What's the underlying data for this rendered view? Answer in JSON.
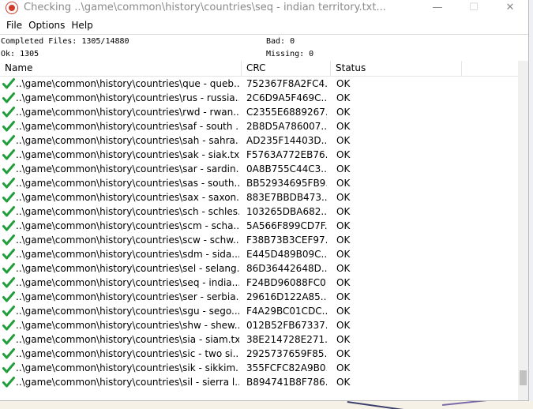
{
  "window": {
    "title": "Checking ..\\game\\common\\history\\countries\\seq - indian territory.txt...",
    "minimize_glyph": "—",
    "maximize_glyph": "☐",
    "close_glyph": "✕"
  },
  "menu": [
    "File",
    "Options",
    "Help"
  ],
  "stats": {
    "completed": "Completed Files: 1305/14880",
    "bad": "Bad: 0",
    "ok": "Ok: 1305",
    "missing": "Missing: 0"
  },
  "columns": {
    "name": "Name",
    "crc": "CRC",
    "status": "Status"
  },
  "rows": [
    {
      "name": "..\\game\\common\\history\\countries\\que - queb...",
      "crc": "752367F8A2FC4...",
      "status": "OK"
    },
    {
      "name": "..\\game\\common\\history\\countries\\rus - russia...",
      "crc": "2C6D9A5F469C...",
      "status": "OK"
    },
    {
      "name": "..\\game\\common\\history\\countries\\rwd - rwan...",
      "crc": "C2355E6889267...",
      "status": "OK"
    },
    {
      "name": "..\\game\\common\\history\\countries\\saf - south ...",
      "crc": "2B8D5A786007...",
      "status": "OK"
    },
    {
      "name": "..\\game\\common\\history\\countries\\sah - sahra...",
      "crc": "AD235F14403D...",
      "status": "OK"
    },
    {
      "name": "..\\game\\common\\history\\countries\\sak - siak.txt",
      "crc": "F5763A772EB76...",
      "status": "OK"
    },
    {
      "name": "..\\game\\common\\history\\countries\\sar - sardin...",
      "crc": "0A8B755C44C3...",
      "status": "OK"
    },
    {
      "name": "..\\game\\common\\history\\countries\\sas - south...",
      "crc": "BB52934695FB9...",
      "status": "OK"
    },
    {
      "name": "..\\game\\common\\history\\countries\\sax - saxon...",
      "crc": "883E7BBDB473...",
      "status": "OK"
    },
    {
      "name": "..\\game\\common\\history\\countries\\sch - schles...",
      "crc": "103265DBA682...",
      "status": "OK"
    },
    {
      "name": "..\\game\\common\\history\\countries\\scm - scha...",
      "crc": "5A566F899CD7F...",
      "status": "OK"
    },
    {
      "name": "..\\game\\common\\history\\countries\\scw - schw...",
      "crc": "F38B73B3CEF97...",
      "status": "OK"
    },
    {
      "name": "..\\game\\common\\history\\countries\\sdm - sida...",
      "crc": "E445D489B09C...",
      "status": "OK"
    },
    {
      "name": "..\\game\\common\\history\\countries\\sel - selang...",
      "crc": "86D36442648D...",
      "status": "OK"
    },
    {
      "name": "..\\game\\common\\history\\countries\\seq - india...",
      "crc": "F24BD96088FC0...",
      "status": "OK"
    },
    {
      "name": "..\\game\\common\\history\\countries\\ser - serbia...",
      "crc": "29616D122A85...",
      "status": "OK"
    },
    {
      "name": "..\\game\\common\\history\\countries\\sgu - sego...",
      "crc": "F4A29BC01CDC...",
      "status": "OK"
    },
    {
      "name": "..\\game\\common\\history\\countries\\shw - shew...",
      "crc": "012B52FB67337...",
      "status": "OK"
    },
    {
      "name": "..\\game\\common\\history\\countries\\sia - siam.txt",
      "crc": "38E214728E271...",
      "status": "OK"
    },
    {
      "name": "..\\game\\common\\history\\countries\\sic - two si...",
      "crc": "2925737659F85...",
      "status": "OK"
    },
    {
      "name": "..\\game\\common\\history\\countries\\sik - sikkim...",
      "crc": "355FCFC82A9B0...",
      "status": "OK"
    },
    {
      "name": "..\\game\\common\\history\\countries\\sil - sierra l...",
      "crc": "B894741B8F786...",
      "status": "OK"
    }
  ],
  "colors": {
    "check_green": "#1f9e3a",
    "app_icon_red": "#d23a2a",
    "title_gray": "#8a8a8a"
  },
  "icons": {
    "app": "app-icon",
    "row_status": "check-icon"
  }
}
